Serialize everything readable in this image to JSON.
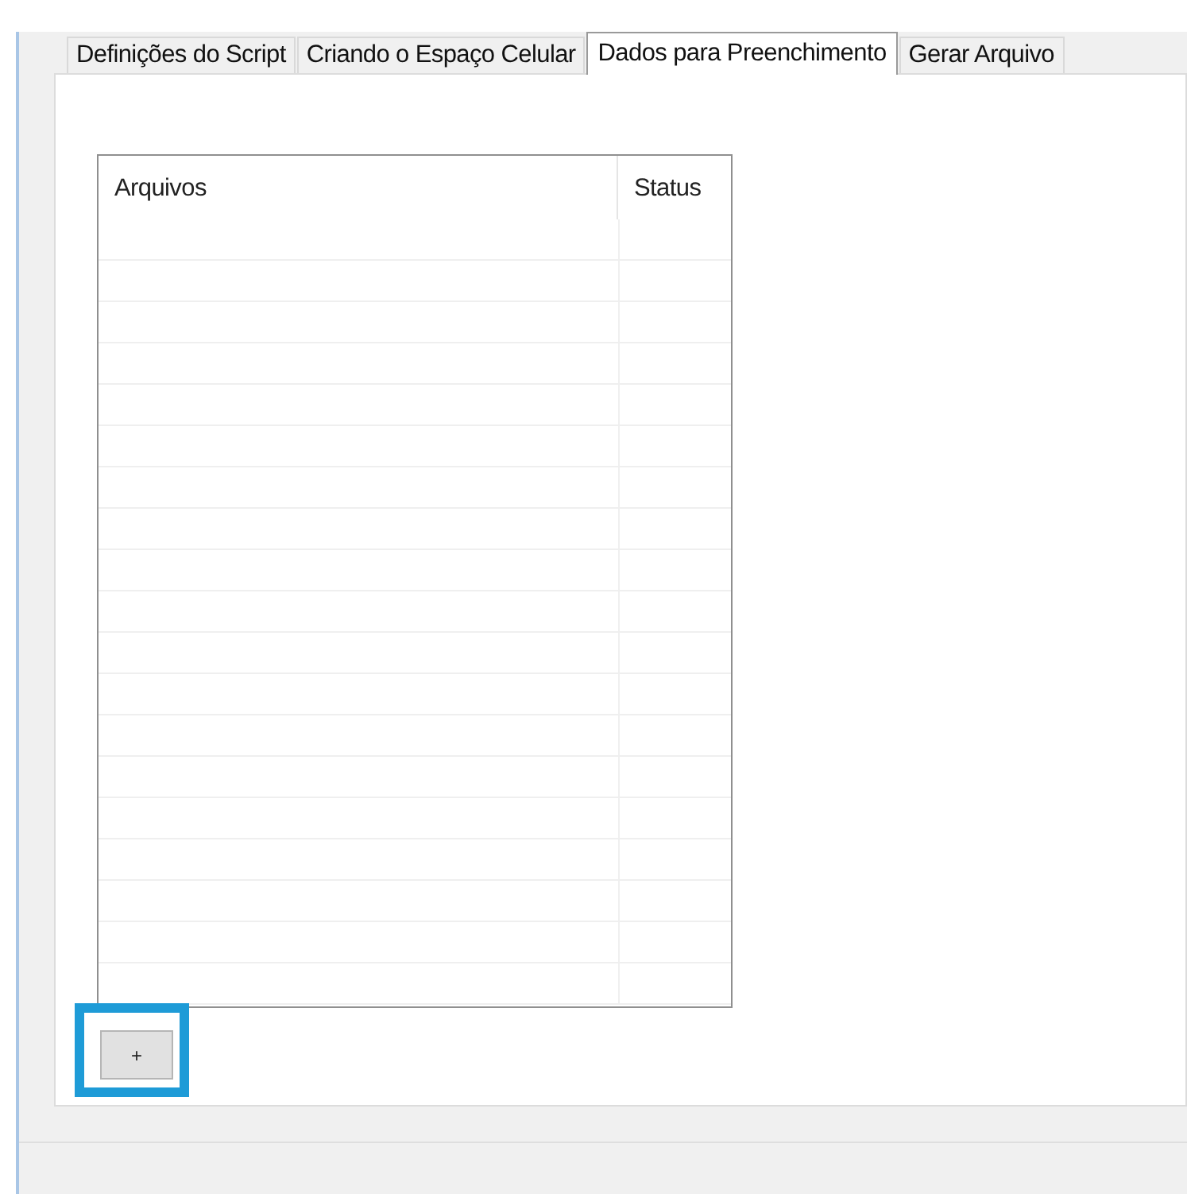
{
  "tabs": [
    {
      "label": "Definições do Script",
      "selected": false
    },
    {
      "label": "Criando o Espaço Celular",
      "selected": false
    },
    {
      "label": "Dados para Preenchimento",
      "selected": true
    },
    {
      "label": "Gerar Arquivo",
      "selected": false
    }
  ],
  "table": {
    "columns": [
      "Arquivos",
      "Status"
    ]
  },
  "add_button": {
    "label": "+",
    "highlighted": true
  }
}
